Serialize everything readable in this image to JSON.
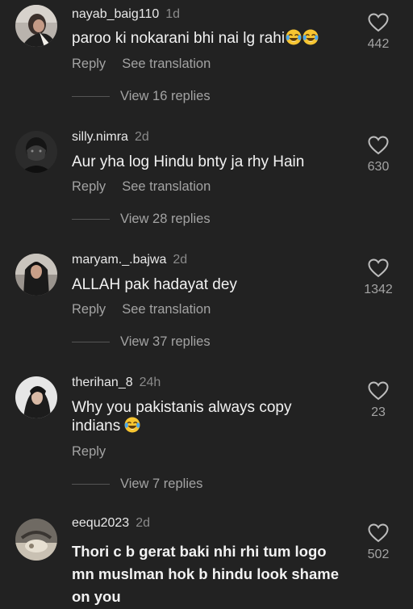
{
  "comments": [
    {
      "username": "nayab_baig110",
      "age": "1d",
      "text": "paroo ki nokarani bhi nai lg rahi",
      "emoji": [
        "face-with-tears-of-joy-icon",
        "face-with-tears-of-joy-icon"
      ],
      "reply_label": "Reply",
      "translate_label": "See translation",
      "likes": "442",
      "view_replies": "View 16 replies"
    },
    {
      "username": "silly.nimra",
      "age": "2d",
      "text": "Aur yha log Hindu bnty ja rhy Hain",
      "reply_label": "Reply",
      "translate_label": "See translation",
      "likes": "630",
      "view_replies": "View 28 replies"
    },
    {
      "username": "maryam._.bajwa",
      "age": "2d",
      "text": "ALLAH pak hadayat dey",
      "reply_label": "Reply",
      "translate_label": "See translation",
      "likes": "1342",
      "view_replies": "View 37 replies"
    },
    {
      "username": "therihan_8",
      "age": "24h",
      "text_line1": "Why you pakistanis always copy",
      "text_line2": "indians",
      "emoji": [
        "face-with-tears-of-joy-icon"
      ],
      "reply_label": "Reply",
      "likes": "23",
      "view_replies": "View 7 replies"
    },
    {
      "username": "eequ2023",
      "age": "2d",
      "text": "Thori c b gerat baki nhi rhi tum logo mn muslman hok b hindu look shame on you",
      "likes": "502"
    }
  ],
  "icons": {
    "like": "heart-outline-icon",
    "emoji": "face-with-tears-of-joy-icon"
  },
  "colors": {
    "background": "#222222",
    "username": "#e8e8e8",
    "secondary_text": "#a3a3a3",
    "body_text": "#f2f2f2"
  }
}
